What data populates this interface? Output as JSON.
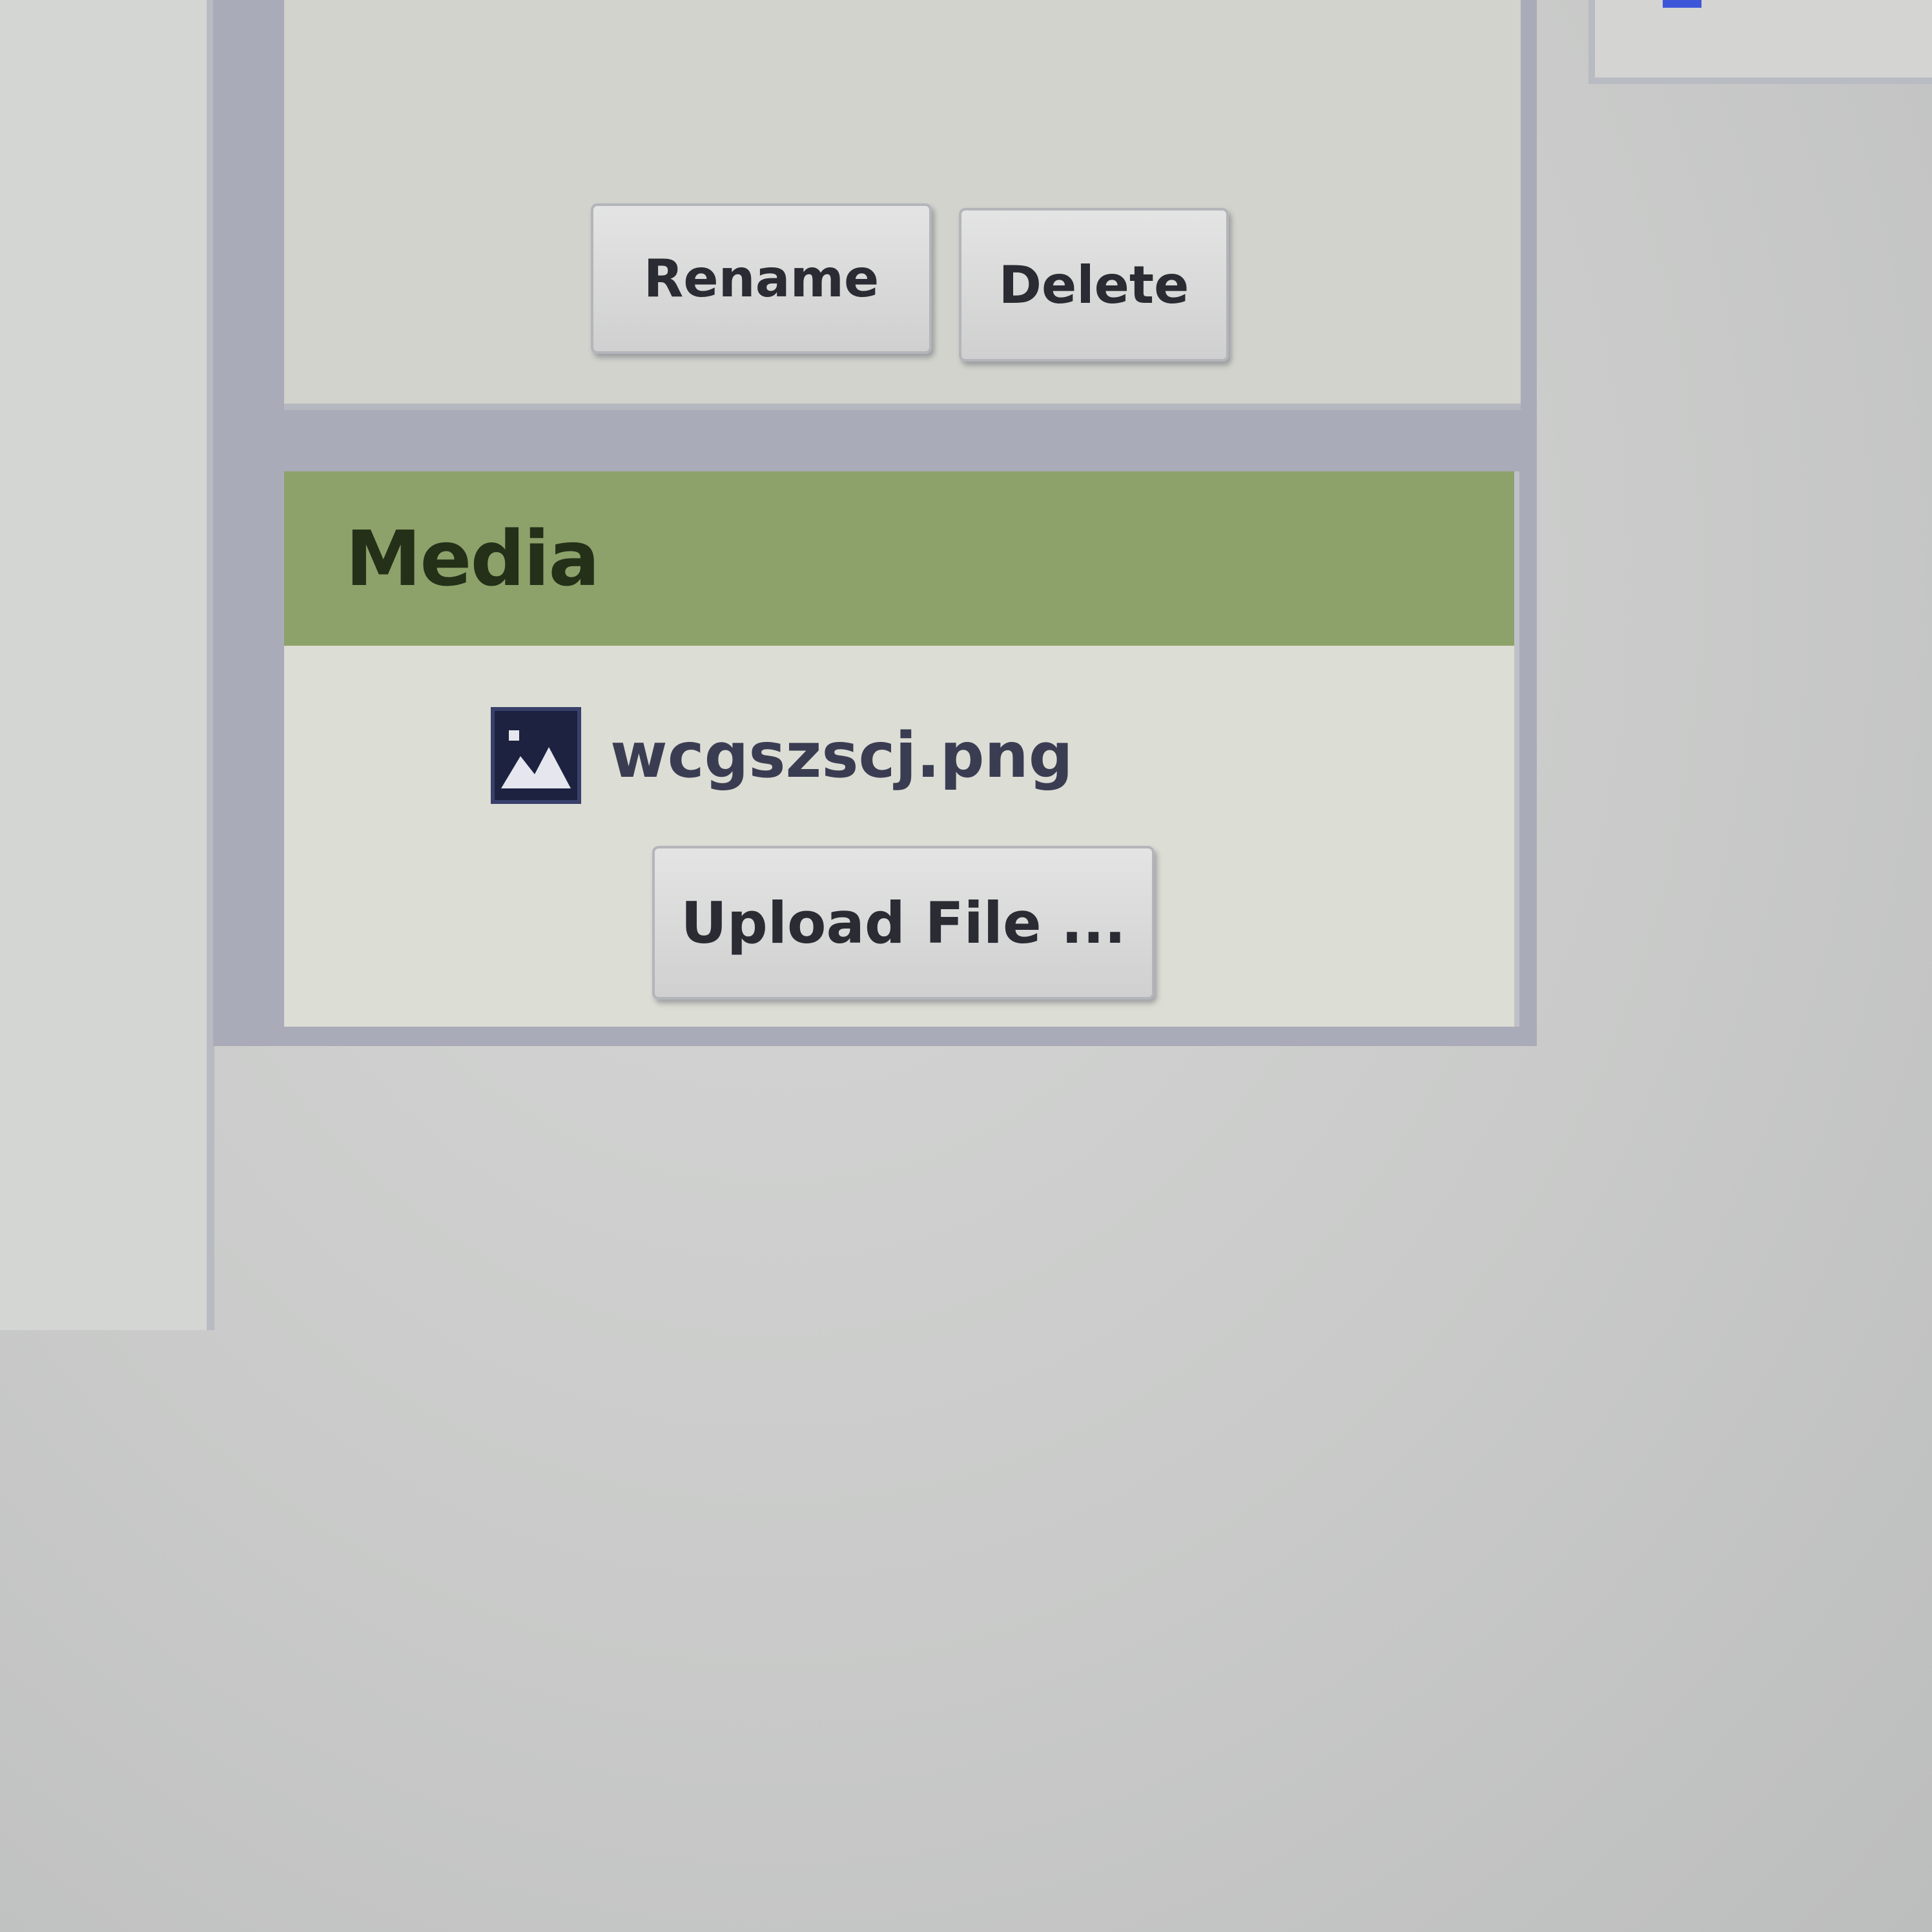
{
  "actions": {
    "rename_label": "Rename",
    "delete_label": "Delete"
  },
  "media": {
    "title": "Media",
    "files": [
      {
        "name": "wcgszscj.png",
        "icon": "image-file-icon"
      }
    ],
    "upload_label": "Upload File ..."
  },
  "colors": {
    "header_green": "#8da26a",
    "panel_bg": "#d6d7cf",
    "frame": "#a9acb8"
  }
}
